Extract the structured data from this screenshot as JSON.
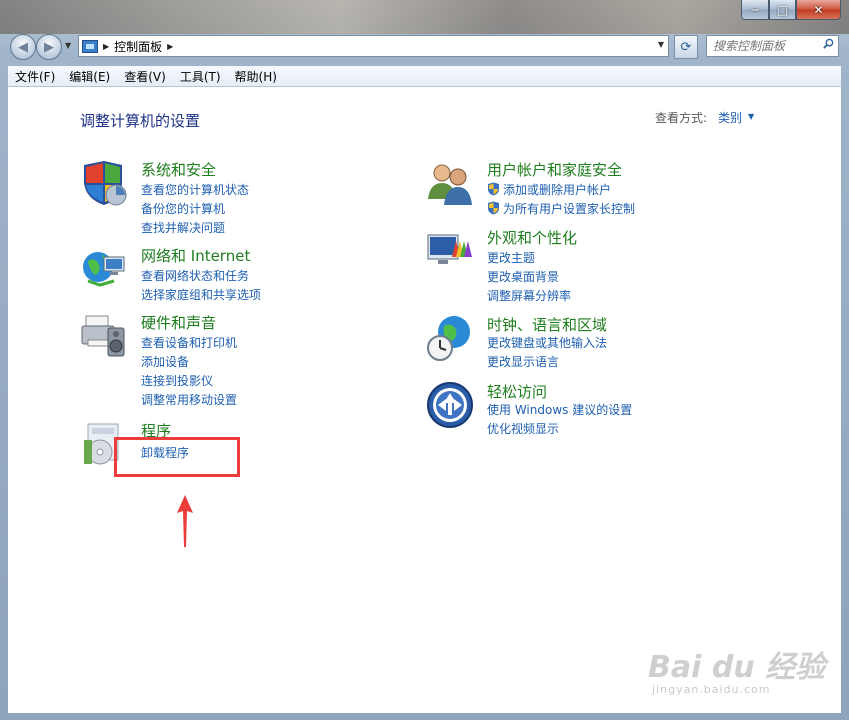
{
  "window": {
    "minimize": "─",
    "maximize": "□",
    "close": "✕"
  },
  "address_bar": {
    "path": "控制面板",
    "separator": "▶"
  },
  "search": {
    "placeholder": "搜索控制面板"
  },
  "menu": [
    "文件(F)",
    "编辑(E)",
    "查看(V)",
    "工具(T)",
    "帮助(H)"
  ],
  "page": {
    "title": "调整计算机的设置",
    "view_by_label": "查看方式:",
    "view_by_value": "类别"
  },
  "categories": {
    "system": {
      "title": "系统和安全",
      "links": [
        "查看您的计算机状态",
        "备份您的计算机",
        "查找并解决问题"
      ]
    },
    "network": {
      "title": "网络和 Internet",
      "links": [
        "查看网络状态和任务",
        "选择家庭组和共享选项"
      ]
    },
    "hardware": {
      "title": "硬件和声音",
      "links": [
        "查看设备和打印机",
        "添加设备",
        "连接到投影仪",
        "调整常用移动设置"
      ]
    },
    "programs": {
      "title": "程序",
      "links": [
        "卸载程序"
      ]
    },
    "users": {
      "title": "用户帐户和家庭安全",
      "links": [
        "添加或删除用户帐户",
        "为所有用户设置家长控制"
      ]
    },
    "appearance": {
      "title": "外观和个性化",
      "links": [
        "更改主题",
        "更改桌面背景",
        "调整屏幕分辨率"
      ]
    },
    "clock": {
      "title": "时钟、语言和区域",
      "links": [
        "更改键盘或其他输入法",
        "更改显示语言"
      ]
    },
    "ease": {
      "title": "轻松访问",
      "links": [
        "使用 Windows 建议的设置",
        "优化视频显示"
      ]
    }
  },
  "watermark": {
    "logo": "Bai du 经验",
    "url": "jingyan.baidu.com"
  },
  "colors": {
    "link": "#1e5fb0",
    "category_title": "#1e7e1e",
    "highlight": "#ec3b3b"
  }
}
